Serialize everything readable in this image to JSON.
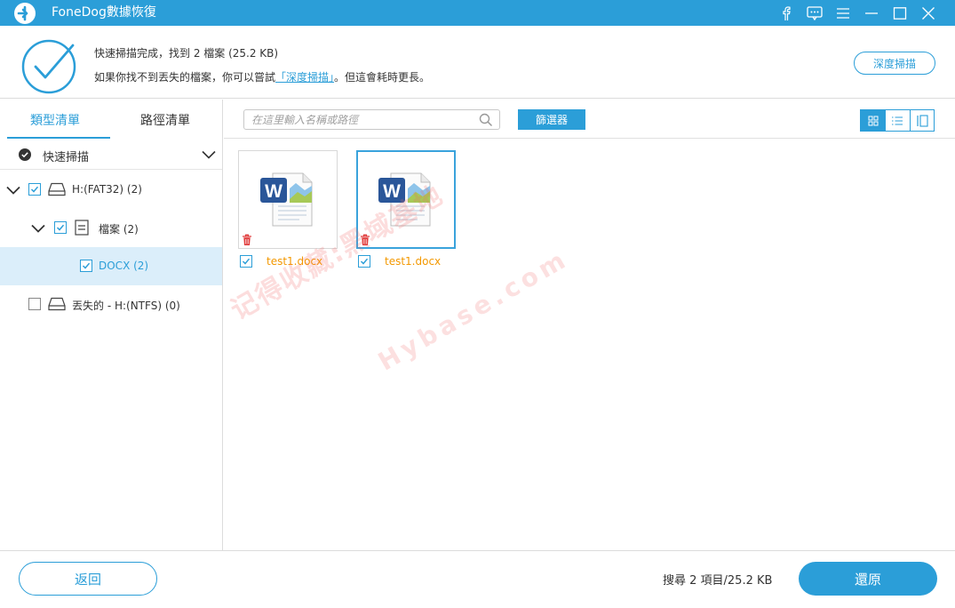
{
  "app": {
    "title": "FoneDog數據恢復"
  },
  "window_controls": [
    "facebook-icon",
    "feedback-icon",
    "menu-icon",
    "minimize-icon",
    "maximize-icon",
    "close-icon"
  ],
  "status": {
    "line1": "快速掃描完成，找到 2 檔案 (25.2 KB)",
    "line2_prefix": "如果你找不到丟失的檔案，你可以嘗試",
    "line2_link": "「深度掃描」",
    "line2_suffix": "。但這會耗時更長。",
    "deep_scan_button": "深度掃描"
  },
  "tabs": [
    {
      "label": "類型清單",
      "active": true
    },
    {
      "label": "路徑清單",
      "active": false
    }
  ],
  "tree": {
    "quick_scan": "快速掃描",
    "items": [
      {
        "label": "H:(FAT32) (2)",
        "checked": true,
        "expanded": true
      },
      {
        "label": "檔案 (2)",
        "checked": true,
        "expanded": true
      },
      {
        "label": "DOCX (2)",
        "checked": true,
        "selected": true
      },
      {
        "label": "丟失的 - H:(NTFS) (0)",
        "checked": false
      }
    ]
  },
  "toolbar": {
    "search_placeholder": "在這里輸入名稱或路徑",
    "filter_label": "篩選器",
    "views": [
      "grid-view-icon",
      "list-view-icon",
      "detail-view-icon"
    ],
    "active_view": "grid"
  },
  "files": [
    {
      "name": "test1.docx",
      "checked": true,
      "selected": false
    },
    {
      "name": "test1.docx",
      "checked": true,
      "selected": true
    }
  ],
  "watermark": {
    "line1": "记得收藏:黑域基地",
    "line2": "Hybase.com"
  },
  "footer": {
    "back_label": "返回",
    "summary": "搜尋 2 項目/25.2 KB",
    "restore_label": "還原"
  },
  "colors": {
    "accent": "#2b9ed8",
    "file_name": "#f39800",
    "selected_row": "#dbeefa"
  }
}
